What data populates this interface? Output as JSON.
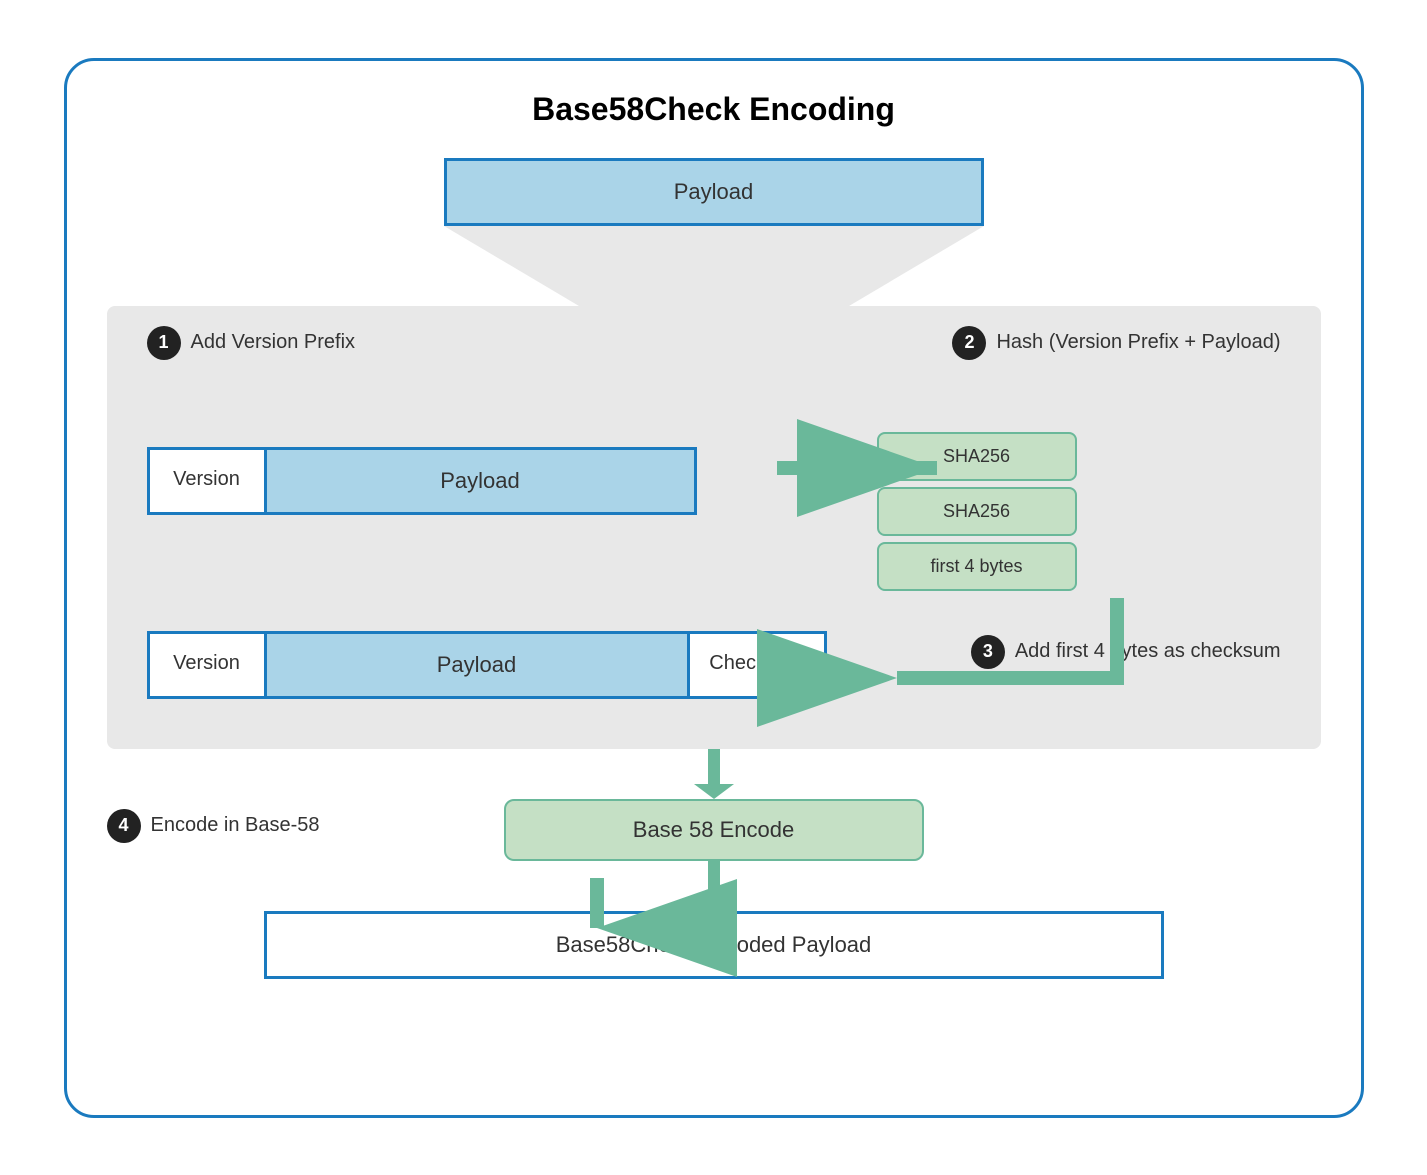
{
  "title": "Base58Check Encoding",
  "colors": {
    "blue_border": "#1a7abf",
    "blue_fill": "#aad4e8",
    "green_fill": "#c5e0c5",
    "green_border": "#6ab89a",
    "grey_bg": "#e8e8e8",
    "white": "#ffffff",
    "black": "#222222"
  },
  "steps": {
    "step1": {
      "number": "1",
      "label": "Add Version Prefix"
    },
    "step2": {
      "number": "2",
      "label": "Hash (Version Prefix + Payload)"
    },
    "step3": {
      "number": "3",
      "label": "Add first 4 bytes as checksum"
    },
    "step4": {
      "number": "4",
      "label": "Encode in Base-58"
    }
  },
  "boxes": {
    "payload_top": "Payload",
    "version1": "Version",
    "payload_mid": "Payload",
    "version2": "Version",
    "payload_lower": "Payload",
    "checksum": "Checksum",
    "sha256_1": "SHA256",
    "sha256_2": "SHA256",
    "first4bytes": "first 4 bytes",
    "base58encode": "Base 58 Encode",
    "final": "Base58Check Encoded Payload"
  }
}
